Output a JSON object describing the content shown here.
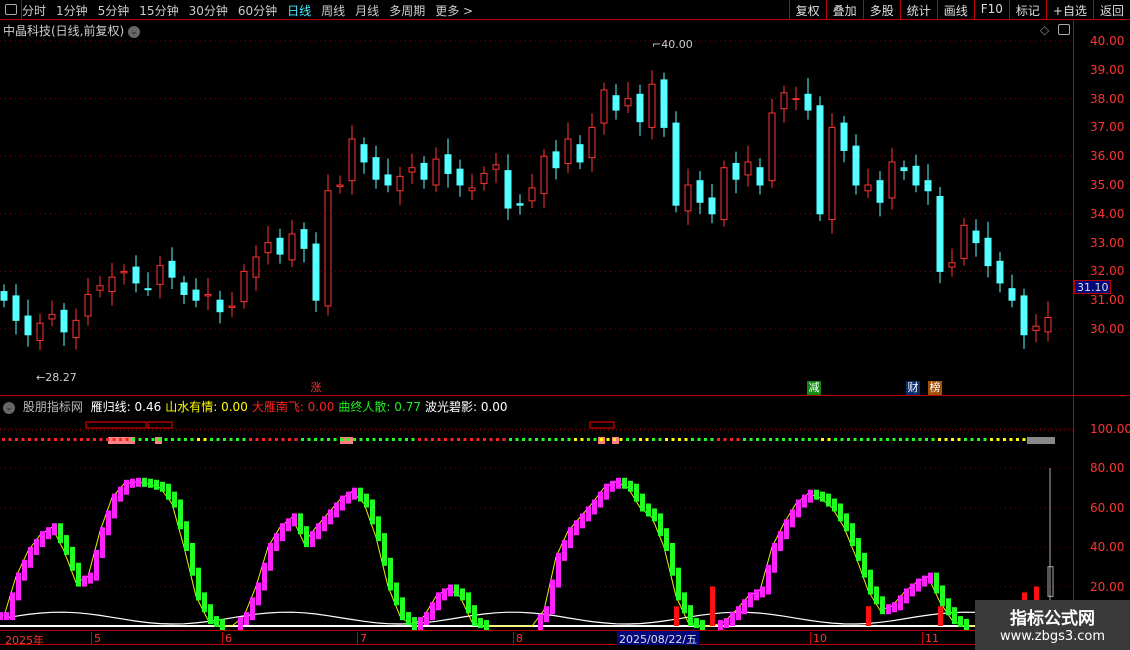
{
  "toolbar": {
    "periods": [
      "分时",
      "1分钟",
      "5分钟",
      "15分钟",
      "30分钟",
      "60分钟",
      "日线",
      "周线",
      "月线",
      "多周期",
      "更多 >"
    ],
    "active": "日线",
    "actions": [
      "复权",
      "叠加",
      "多股",
      "统计",
      "画线",
      "F10",
      "标记",
      "+自选",
      "返回"
    ]
  },
  "stock_title": "中晶科技(日线,前复权)",
  "price_axis": [
    "40.00",
    "39.00",
    "38.00",
    "37.00",
    "36.00",
    "35.00",
    "34.00",
    "33.00",
    "32.00",
    "31.00",
    "30.00"
  ],
  "last_price": "31.10",
  "annotations": {
    "high": "40.00",
    "low": "28.27"
  },
  "markers": [
    {
      "text": "涨",
      "color": "#ff3333",
      "bg": "transparent"
    },
    {
      "text": "减",
      "color": "#ffffff",
      "bg": "#118811"
    },
    {
      "text": "财",
      "color": "#ffffff",
      "bg": "#0b2d6b"
    },
    {
      "text": "榜",
      "color": "#ffffff",
      "bg": "#a0520a"
    }
  ],
  "indicator": {
    "name": "股朋指标网",
    "values": [
      {
        "label": "雁归线: 0.46",
        "color": "#ffffff"
      },
      {
        "label": "山水有情: 0.00",
        "color": "#ffff00"
      },
      {
        "label": "大雁南飞: 0.00",
        "color": "#ff2222"
      },
      {
        "label": "曲终人散: 0.77",
        "color": "#22ee22"
      },
      {
        "label": "波光碧影: 0.00",
        "color": "#ffffff"
      }
    ],
    "axis": [
      "100.00",
      "80.00",
      "60.00",
      "40.00",
      "20.00"
    ]
  },
  "dates": {
    "labels": [
      "2025年",
      "5",
      "6",
      "7",
      "8",
      "10",
      "11"
    ],
    "highlight": "2025/08/22/五"
  },
  "watermark": {
    "line1": "指标公式网",
    "line2": "www.zbgs3.com"
  },
  "colors": {
    "up": "#ff3333",
    "down": "#54ffff",
    "rise": "#ff22ff",
    "fall": "#22ff22",
    "bar": "#ff1111"
  },
  "chart_data": {
    "type": "candlestick+indicator",
    "close": [
      31.0,
      30.3,
      29.8,
      30.2,
      30.5,
      29.9,
      30.3,
      31.2,
      31.5,
      31.8,
      32.0,
      31.6,
      31.4,
      32.2,
      31.8,
      31.2,
      31.0,
      31.2,
      30.6,
      30.8,
      32.0,
      32.5,
      33.0,
      32.6,
      33.3,
      32.8,
      31.0,
      34.8,
      35.0,
      36.6,
      35.8,
      35.2,
      35.0,
      35.3,
      35.6,
      35.2,
      35.9,
      35.4,
      35.0,
      34.9,
      35.4,
      35.7,
      34.2,
      34.3,
      34.9,
      36.0,
      35.6,
      36.6,
      35.8,
      37.0,
      38.3,
      37.6,
      38.0,
      37.2,
      38.5,
      37.0,
      34.3,
      35.0,
      34.4,
      34.0,
      35.6,
      35.2,
      35.8,
      35.0,
      37.5,
      38.2,
      38.0,
      37.6,
      34.0,
      37.0,
      36.2,
      35.0,
      35.0,
      34.4,
      35.8,
      35.5,
      35.0,
      34.8,
      32.0,
      32.3,
      33.6,
      33.0,
      32.2,
      31.6,
      31.0,
      29.8,
      30.1,
      30.4
    ],
    "oscillator": [
      5,
      25,
      38,
      46,
      50,
      38,
      22,
      25,
      48,
      65,
      72,
      73,
      72,
      70,
      62,
      40,
      15,
      3,
      0,
      0,
      5,
      20,
      40,
      50,
      55,
      42,
      50,
      57,
      64,
      68,
      62,
      45,
      20,
      5,
      0,
      5,
      15,
      19,
      15,
      2,
      0,
      0,
      0,
      0,
      0,
      8,
      35,
      48,
      55,
      62,
      70,
      73,
      70,
      60,
      55,
      40,
      15,
      2,
      0,
      0,
      2,
      8,
      15,
      18,
      40,
      52,
      62,
      67,
      65,
      60,
      50,
      35,
      18,
      8,
      10,
      17,
      22,
      25,
      12,
      3,
      0,
      0,
      0,
      0,
      0,
      0,
      0,
      0
    ],
    "red_bars": {
      "56": 10,
      "59": 20,
      "72": 10,
      "78": 10,
      "83": 8,
      "84": 13,
      "85": 17,
      "86": 20
    },
    "signal_dots": "rrrrrrrrrrgggggygggrrrrgggggggggrrrrrrrgggggygyygygyyggrrggggggyggggggggyyggyyyggggggggg",
    "price_range": [
      27.5,
      41
    ],
    "osc_range": [
      0,
      110
    ]
  }
}
